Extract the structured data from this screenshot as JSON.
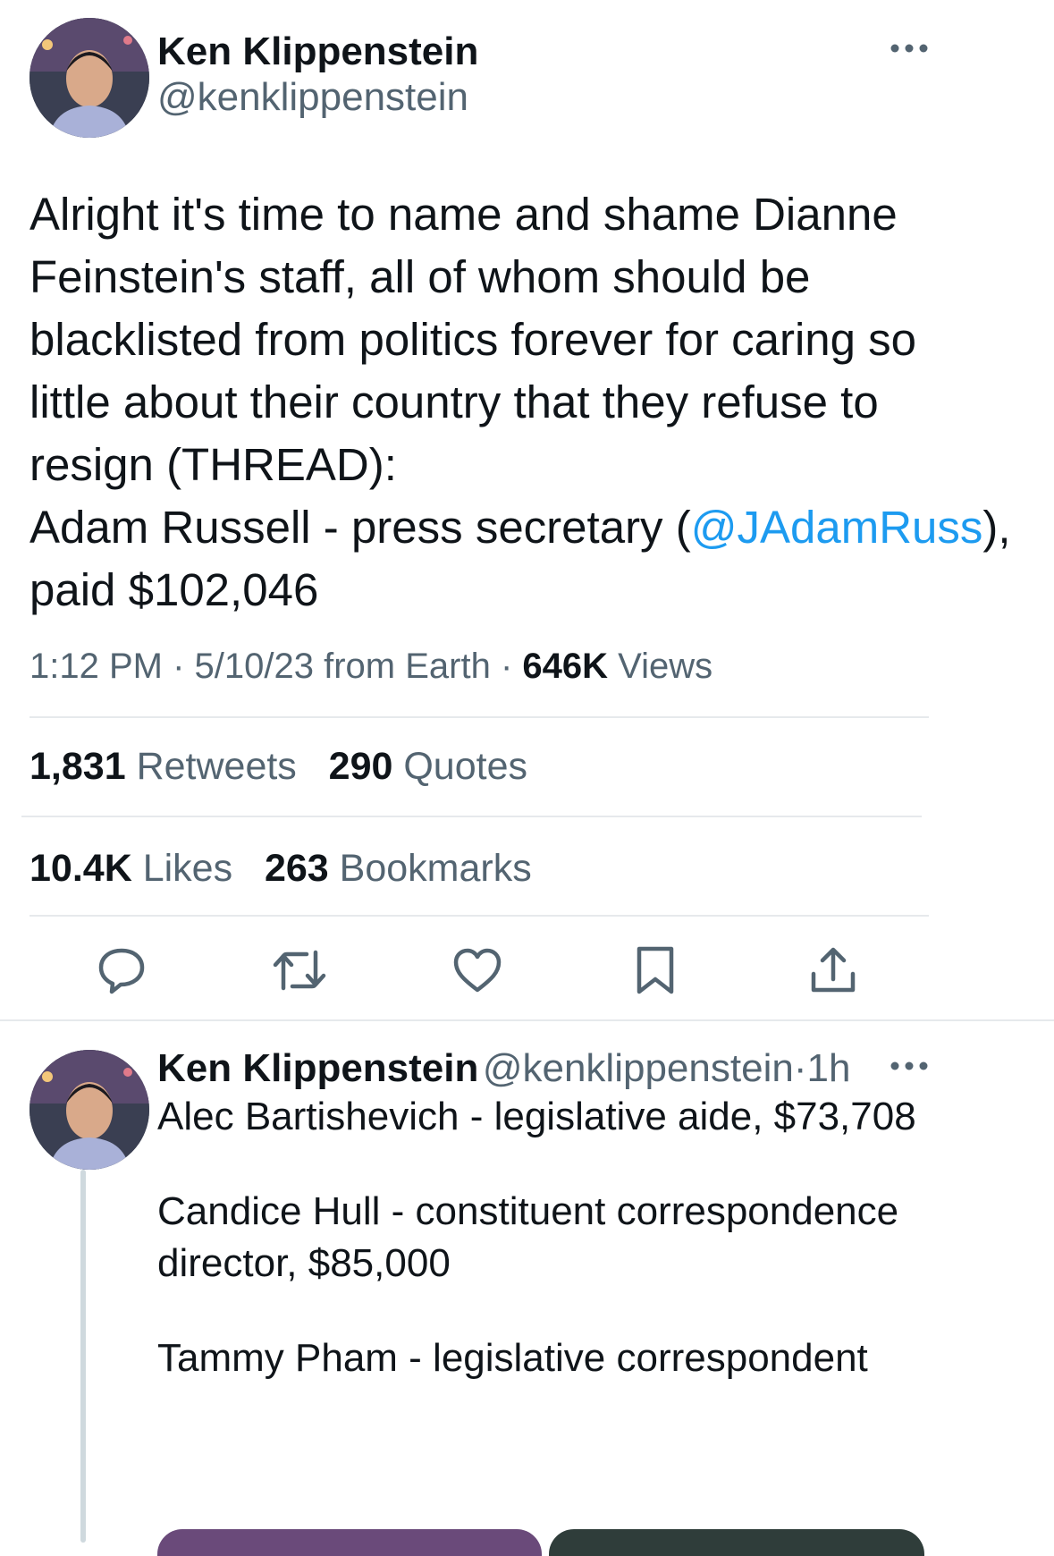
{
  "main_tweet": {
    "author_name": "Ken Klippenstein",
    "author_handle": "@kenklippenstein",
    "text_line1": "Alright it's time to name and shame Dianne",
    "text_line2": "Feinstein's staff, all of whom should be",
    "text_line3": "blacklisted from politics forever for caring so",
    "text_line4": "little about their country that they refuse to",
    "text_line5": "resign (THREAD):",
    "text_line6_pre": "Adam Russell - press secretary (",
    "text_line6_mention": "@JAdamRuss",
    "text_line6_post": "),",
    "text_line7": "paid $102,046",
    "time": "1:12 PM",
    "sep1": "·",
    "date": "5/10/23 from Earth",
    "sep2": "·",
    "views_count": "646K",
    "views_label": "Views"
  },
  "stats": {
    "retweets_count": "1,831",
    "retweets_label": "Retweets",
    "quotes_count": "290",
    "quotes_label": "Quotes",
    "likes_count": "10.4K",
    "likes_label": "Likes",
    "bookmarks_count": "263",
    "bookmarks_label": "Bookmarks"
  },
  "actions": [
    "reply-icon",
    "retweet-icon",
    "like-icon",
    "bookmark-icon",
    "share-icon"
  ],
  "reply_tweet": {
    "author_name": "Ken Klippenstein",
    "author_handle": "@kenklippenstein",
    "sep": "·",
    "age": "1h",
    "line1": "Alec Bartishevich - legislative aide, $73,708",
    "line2": "Candice Hull - constituent correspondence",
    "line3": "director, $85,000",
    "line4": "Tammy Pham - legislative correspondent"
  },
  "colors": {
    "text": "#0f1419",
    "secondary": "#536471",
    "accent": "#1d9bf0",
    "divider": "#e6e9ec"
  }
}
